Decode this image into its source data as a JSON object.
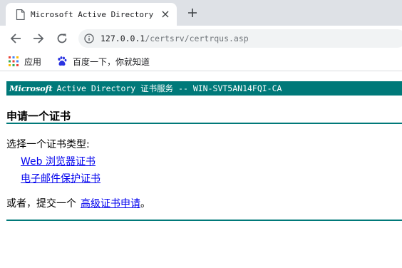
{
  "browser": {
    "tab": {
      "title": "Microsoft Active Directory 证书服务",
      "favicon": "document-icon",
      "close": "×"
    },
    "new_tab": "plus-icon",
    "toolbar": {
      "back": "arrow-left-icon",
      "forward": "arrow-right-icon",
      "reload": "reload-icon",
      "site_info": "info-icon"
    },
    "url": {
      "host": "127.0.0.1",
      "path": "/certsrv/certrqus.asp"
    },
    "bookmarks": [
      {
        "label": "应用",
        "icon": "apps-grid-icon"
      },
      {
        "label": "百度一下，你就知道",
        "icon": "baidu-paw-icon"
      }
    ]
  },
  "page": {
    "banner": {
      "logo": "Microsoft",
      "text": "Active Directory 证书服务  --  WIN-SVT5AN14FQI-CA"
    },
    "heading": "申请一个证书",
    "prompt": "选择一个证书类型:",
    "cert_types": [
      {
        "label": "Web 浏览器证书"
      },
      {
        "label": "电子邮件保护证书"
      }
    ],
    "alt_text": "或者，提交一个",
    "alt_link": "高级证书申请",
    "alt_end": "。"
  },
  "colors": {
    "accent": "#007979",
    "link": "#0000ee",
    "tabstrip": "#dee1e6",
    "omnibox": "#f1f3f4"
  }
}
